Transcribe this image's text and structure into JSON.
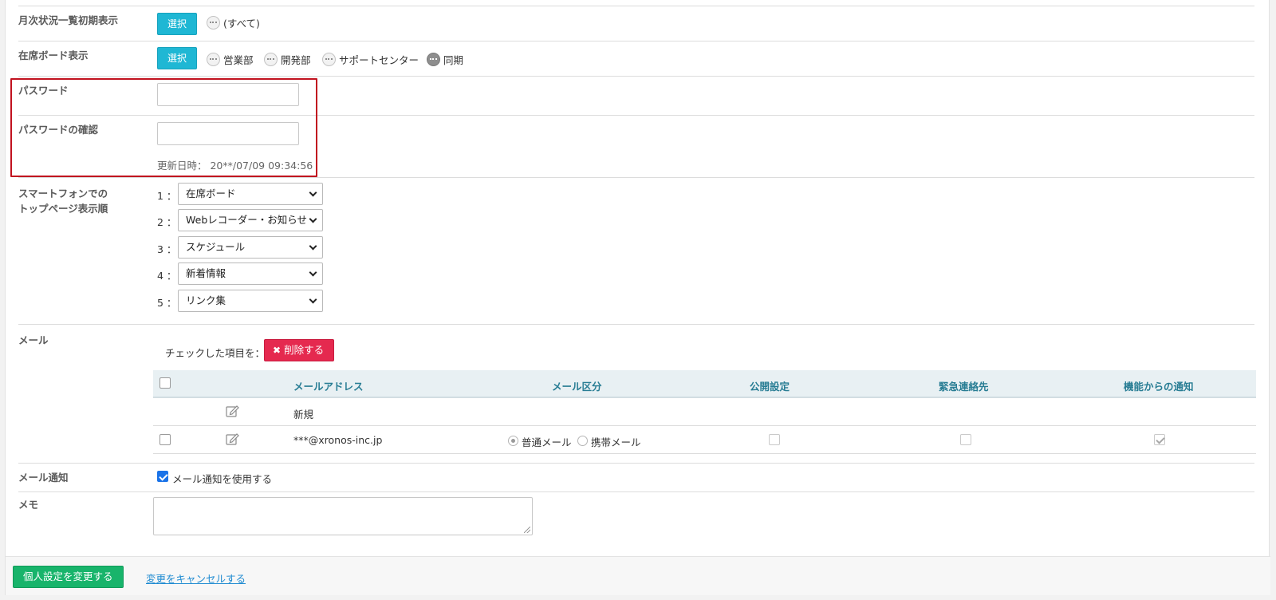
{
  "rows": {
    "monthly_status": {
      "label": "月次状況一覧初期表示",
      "select_label": "選択",
      "groups": [
        "(すべて)"
      ]
    },
    "presence_board": {
      "label": "在席ボード表示",
      "select_label": "選択",
      "groups": [
        "営業部",
        "開発部",
        "サポートセンター",
        "同期"
      ]
    },
    "password": {
      "label": "パスワード",
      "value": ""
    },
    "password_confirm": {
      "label": "パスワードの確認",
      "value": "",
      "updated_text": "更新日時： 20**/07/09 09:34:56"
    },
    "smartphone_order": {
      "label_line1": "スマートフォンでの",
      "label_line2": "トップページ表示順",
      "items": [
        {
          "num": "1 ：",
          "value": "在席ボード"
        },
        {
          "num": "2 ：",
          "value": "Webレコーダー・お知らせ"
        },
        {
          "num": "3 ：",
          "value": "スケジュール"
        },
        {
          "num": "4 ：",
          "value": "新着情報"
        },
        {
          "num": "5 ：",
          "value": "リンク集"
        }
      ]
    },
    "mail": {
      "label": "メール",
      "checked_items_text": "チェックした項目を：",
      "delete_label": "削除する",
      "headers": {
        "address": "メールアドレス",
        "type": "メール区分",
        "public": "公開設定",
        "emergency": "緊急連絡先",
        "notify": "機能からの通知"
      },
      "new_row_label": "新規",
      "entries": [
        {
          "address": "***@xronos-inc.jp",
          "type_normal": "普通メール",
          "type_mobile": "携帯メール"
        }
      ]
    },
    "mail_notify": {
      "label": "メール通知",
      "checkbox_label": "メール通知を使用する"
    },
    "memo": {
      "label": "メモ",
      "value": ""
    }
  },
  "footer": {
    "save_label": "個人設定を変更する",
    "cancel_label": "変更をキャンセルする"
  },
  "colors": {
    "select_button": "#1fb7d4",
    "delete_button": "#e5294f",
    "save_button": "#18b46b",
    "highlight_box": "#c1121f",
    "table_header_text": "#287d94",
    "link": "#1f8bd1"
  }
}
